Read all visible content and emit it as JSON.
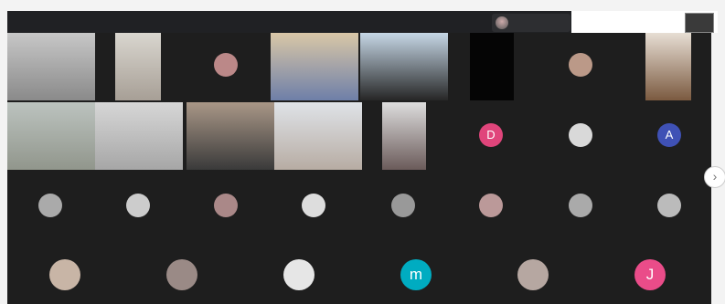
{
  "top_bar": {
    "speaker_name": "",
    "controls": {
      "a": "",
      "b": "",
      "time": ""
    }
  },
  "gallery": {
    "labels": {
      "t6": ""
    },
    "avatars": {
      "d": "D",
      "a": "A",
      "m": "m",
      "j": "J"
    }
  },
  "colors": {
    "d": "#e0457b",
    "a": "#3f51b5",
    "m": "#00acc1",
    "j": "#ea4c89"
  }
}
